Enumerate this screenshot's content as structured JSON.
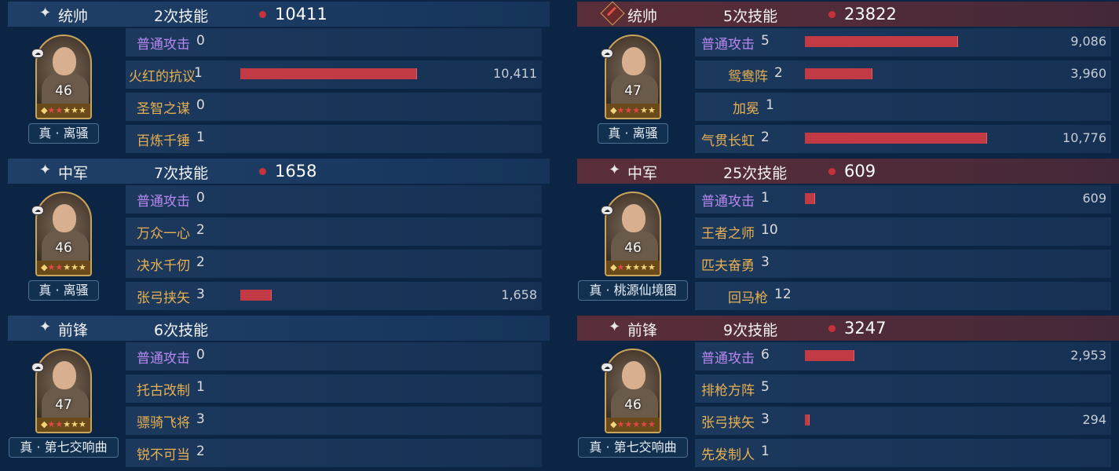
{
  "left": [
    {
      "role": "统帅",
      "casts": "2次技能",
      "damage": "10411",
      "level": "46",
      "tag": "真 · 离骚",
      "stars": [
        "gold",
        "red",
        "red",
        "gold",
        "gold",
        "gold"
      ],
      "skills": [
        {
          "name": "普通攻击",
          "count": "0",
          "type": "normal",
          "bar": 0,
          "value": ""
        },
        {
          "name": "火红的抗议",
          "count": "1",
          "type": "skill",
          "bar": 0.9,
          "value": "10,411"
        },
        {
          "name": "圣智之谋",
          "count": "0",
          "type": "skill",
          "bar": 0,
          "value": ""
        },
        {
          "name": "百炼千锤",
          "count": "1",
          "type": "skill",
          "bar": 0,
          "value": ""
        }
      ]
    },
    {
      "role": "中军",
      "casts": "7次技能",
      "damage": "1658",
      "level": "46",
      "tag": "真 · 离骚",
      "stars": [
        "gold",
        "red",
        "red",
        "gold",
        "gold",
        "gold"
      ],
      "skills": [
        {
          "name": "普通攻击",
          "count": "0",
          "type": "normal",
          "bar": 0,
          "value": ""
        },
        {
          "name": "万众一心",
          "count": "2",
          "type": "skill",
          "bar": 0,
          "value": ""
        },
        {
          "name": "决水千仞",
          "count": "2",
          "type": "skill",
          "bar": 0,
          "value": ""
        },
        {
          "name": "张弓挟矢",
          "count": "3",
          "type": "skill",
          "bar": 0.16,
          "value": "1,658"
        }
      ]
    },
    {
      "role": "前锋",
      "casts": "6次技能",
      "damage": "",
      "level": "47",
      "tag": "真 · 第七交响曲",
      "stars": [
        "gold",
        "red",
        "red",
        "gold",
        "gold",
        "gold"
      ],
      "skills": [
        {
          "name": "普通攻击",
          "count": "0",
          "type": "normal",
          "bar": 0,
          "value": ""
        },
        {
          "name": "托古改制",
          "count": "1",
          "type": "skill",
          "bar": 0,
          "value": ""
        },
        {
          "name": "骠骑飞将",
          "count": "3",
          "type": "skill",
          "bar": 0,
          "value": ""
        },
        {
          "name": "锐不可当",
          "count": "2",
          "type": "skill",
          "bar": 0,
          "value": ""
        }
      ]
    }
  ],
  "right": [
    {
      "role": "统帅",
      "casts": "5次技能",
      "damage": "23822",
      "level": "47",
      "tag": "真 · 离骚",
      "badge": true,
      "stars": [
        "gold",
        "red",
        "red",
        "red",
        "gold",
        "gold"
      ],
      "skills": [
        {
          "name": "普通攻击",
          "count": "5",
          "type": "normal",
          "bar": 0.84,
          "value": "9,086"
        },
        {
          "name": "鸳鸯阵",
          "count": "2",
          "type": "skill",
          "bar": 0.37,
          "value": "3,960"
        },
        {
          "name": "加冕",
          "count": "1",
          "type": "skill",
          "bar": 0,
          "value": ""
        },
        {
          "name": "气贯长虹",
          "count": "2",
          "type": "skill",
          "bar": 1.0,
          "value": "10,776"
        }
      ]
    },
    {
      "role": "中军",
      "casts": "25次技能",
      "damage": "609",
      "level": "46",
      "tag": "真 · 桃源仙境图",
      "stars": [
        "gold",
        "red",
        "gold",
        "gold",
        "gold",
        "gold"
      ],
      "skills": [
        {
          "name": "普通攻击",
          "count": "1",
          "type": "normal",
          "bar": 0.056,
          "value": "609"
        },
        {
          "name": "王者之师",
          "count": "10",
          "type": "skill",
          "bar": 0,
          "value": ""
        },
        {
          "name": "匹夫奋勇",
          "count": "3",
          "type": "skill",
          "bar": 0,
          "value": ""
        },
        {
          "name": "回马枪",
          "count": "12",
          "type": "skill",
          "bar": 0,
          "value": ""
        }
      ]
    },
    {
      "role": "前锋",
      "casts": "9次技能",
      "damage": "3247",
      "level": "46",
      "tag": "真 · 第七交响曲",
      "stars": [
        "gold",
        "red",
        "red",
        "red",
        "red",
        "red"
      ],
      "skills": [
        {
          "name": "普通攻击",
          "count": "6",
          "type": "normal",
          "bar": 0.27,
          "value": "2,953"
        },
        {
          "name": "排枪方阵",
          "count": "5",
          "type": "skill",
          "bar": 0,
          "value": ""
        },
        {
          "name": "张弓挟矢",
          "count": "3",
          "type": "skill",
          "bar": 0.027,
          "value": "294"
        },
        {
          "name": "先发制人",
          "count": "1",
          "type": "skill",
          "bar": 0,
          "value": ""
        }
      ]
    }
  ]
}
